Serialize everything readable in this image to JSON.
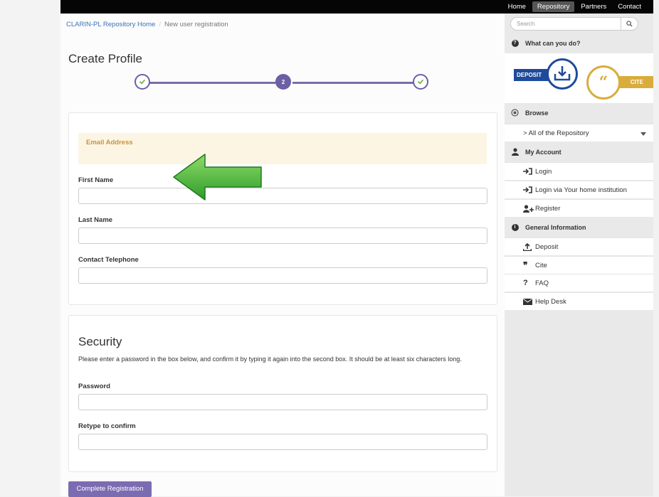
{
  "topnav": {
    "items": [
      "Home",
      "Repository",
      "Partners",
      "Contact"
    ],
    "active": "Repository"
  },
  "breadcrumb": {
    "home": "CLARIN-PL Repository Home",
    "current": "New user registration"
  },
  "page_title": "Create Profile",
  "stepper": {
    "steps": [
      "",
      "2",
      ""
    ],
    "current_step": 2
  },
  "profile": {
    "email_label": "Email Address",
    "first_name_label": "First Name",
    "last_name_label": "Last Name",
    "phone_label": "Contact Telephone"
  },
  "security": {
    "title": "Security",
    "description": "Please enter a password in the box below, and confirm it by typing it again into the second box. It should be at least six characters long.",
    "password_label": "Password",
    "retype_label": "Retype to confirm"
  },
  "submit_label": "Complete Registration",
  "sidebar": {
    "search_placeholder": "Search",
    "what_can_you_do": "What can you do?",
    "deposit_logo": "DEPOSIT",
    "cite_logo": "CITE",
    "browse": "Browse",
    "browse_item": "> All of the Repository",
    "my_account": "My Account",
    "login": "Login",
    "login_institution": "Login via Your home institution",
    "register": "Register",
    "general_information": "General Information",
    "deposit": "Deposit",
    "cite": "Cite",
    "faq": "FAQ",
    "help_desk": "Help Desk"
  },
  "colors": {
    "accent": "#6d5fa5",
    "link": "#3b73b9",
    "topbar": "#050505",
    "warning_bg": "#fcf5e4",
    "annotation_arrow": "#3aa635"
  }
}
